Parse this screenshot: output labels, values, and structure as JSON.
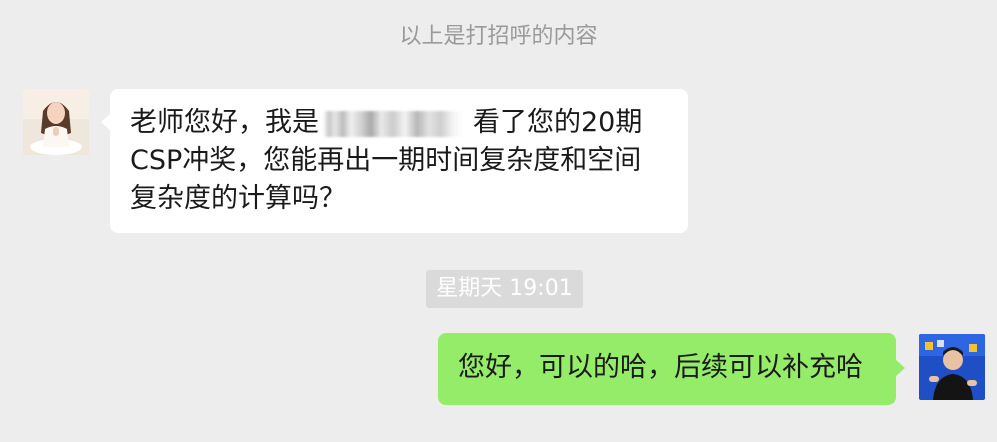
{
  "chat": {
    "system_note": "以上是打招呼的内容",
    "timestamp": "星期天 19:01",
    "incoming_message": {
      "text_before_redaction": "老师您好，我是",
      "text_after_redaction": "看了您的20期CSP冲奖，您能再出一期时间复杂度和空间复杂度的计算吗？"
    },
    "outgoing_message": {
      "text": "您好，可以的哈，后续可以补充哈"
    }
  },
  "colors": {
    "background": "#ededed",
    "incoming_bubble": "#ffffff",
    "outgoing_bubble": "#95ec69",
    "system_text": "#9a9a9a",
    "timestamp_bg": "#dadada"
  }
}
